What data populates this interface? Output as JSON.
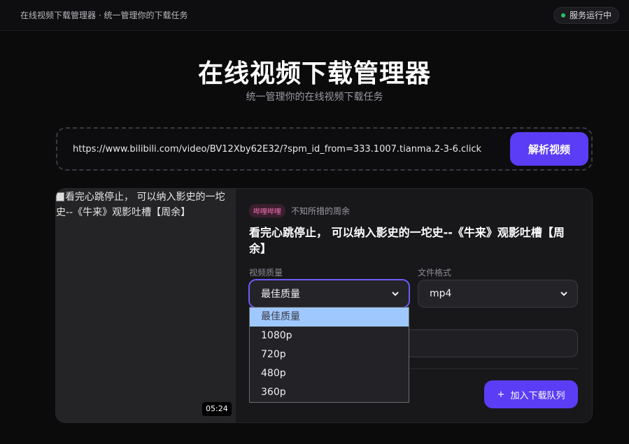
{
  "topbar": {
    "title": "在线视频下载管理器 · 统一管理你的下载任务",
    "status": "服务运行中",
    "status_color": "#22c55e"
  },
  "hero": {
    "title": "在线视频下载管理器",
    "subtitle": "统一管理你的在线视频下载任务"
  },
  "url_bar": {
    "value": "https://www.bilibili.com/video/BV12Xby62E32/?spm_id_from=333.1007.tianma.2-3-6.click",
    "parse_button": "解析视频"
  },
  "video": {
    "thumbnail_alt": "看完心跳停止， 可以纳入影史的一坨史--《牛来》观影吐槽【周余】",
    "duration": "05:24",
    "platform": "哔哩哔哩",
    "uploader": "不知所措的周余",
    "title": "看完心跳停止， 可以纳入影史的一坨史--《牛来》观影吐槽【周余】"
  },
  "options": {
    "quality_label": "视频质量",
    "quality_value": "最佳质量",
    "format_label": "文件格式",
    "format_value": "mp4",
    "quality_options": [
      "最佳质量",
      "1080p",
      "720p",
      "480p",
      "360p"
    ]
  },
  "actions": {
    "add_to_queue": "加入下载队列",
    "add_icon": "plus-icon"
  },
  "colors": {
    "accent": "#5b3df5",
    "background": "#0b0b0c",
    "card": "#18181b"
  }
}
